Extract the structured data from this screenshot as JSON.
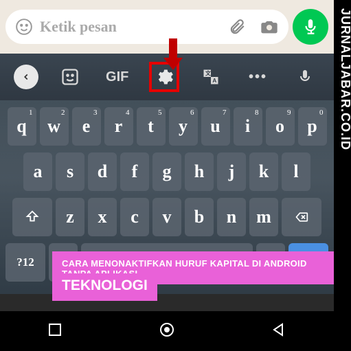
{
  "whatsapp": {
    "placeholder": "Ketik pesan"
  },
  "toolbar": {
    "gif_label": "GIF"
  },
  "keyboard": {
    "row1": [
      {
        "k": "q",
        "n": "1"
      },
      {
        "k": "w",
        "n": "2"
      },
      {
        "k": "e",
        "n": "3"
      },
      {
        "k": "r",
        "n": "4"
      },
      {
        "k": "t",
        "n": "5"
      },
      {
        "k": "y",
        "n": "6"
      },
      {
        "k": "u",
        "n": "7"
      },
      {
        "k": "i",
        "n": "8"
      },
      {
        "k": "o",
        "n": "9"
      },
      {
        "k": "p",
        "n": "0"
      }
    ],
    "row2": [
      {
        "k": "a"
      },
      {
        "k": "s"
      },
      {
        "k": "d"
      },
      {
        "k": "f"
      },
      {
        "k": "g"
      },
      {
        "k": "h"
      },
      {
        "k": "j"
      },
      {
        "k": "k"
      },
      {
        "k": "l"
      }
    ],
    "row3": [
      {
        "k": "z"
      },
      {
        "k": "x"
      },
      {
        "k": "c"
      },
      {
        "k": "v"
      },
      {
        "k": "b"
      },
      {
        "k": "n"
      },
      {
        "k": "m"
      }
    ],
    "symbols_label": "?12"
  },
  "banner": {
    "title": "CARA MENONAKTIFKAN HURUF KAPITAL DI ANDROID TANPA APLIKASI",
    "category": "TEKNOLOGI"
  },
  "watermark": "JURNALJABAR.CO.ID"
}
